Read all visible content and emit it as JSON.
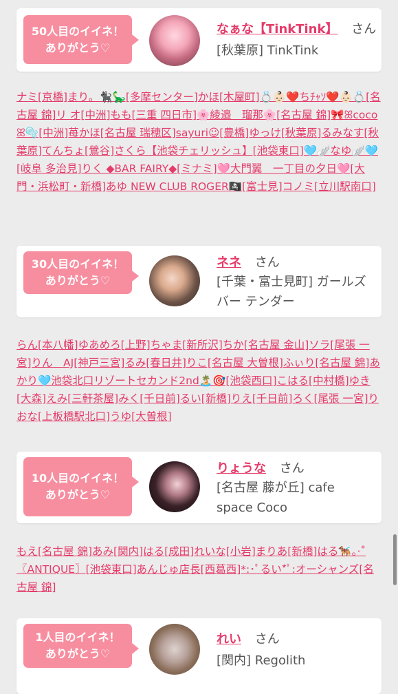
{
  "cards": [
    {
      "badge_line1": "50人目のイイネ！",
      "badge_line2": "ありがとう♡",
      "name": "なぁな【TinkTink】",
      "honorific": "さん",
      "shop": "[秋葉原] TinkTink"
    },
    {
      "badge_line1": "30人目のイイネ！",
      "badge_line2": "ありがとう♡",
      "name": "ネネ",
      "honorific": "さん",
      "shop": "[千葉・富士見町] ガールズバー テンダー"
    },
    {
      "badge_line1": "10人目のイイネ！",
      "badge_line2": "ありがとう♡",
      "name": "りょうな",
      "honorific": "さん",
      "shop": "[名古屋 藤が丘] cafe space Coco"
    },
    {
      "badge_line1": "1人目のイイネ！",
      "badge_line2": "ありがとう♡",
      "name": "れい",
      "honorific": "さん",
      "shop": "[関内] Regolith"
    }
  ],
  "likers": [
    "ナミ[京橋]まり。🐈‍⬛🦕[多摩センター]かほ[木屋町]💍👶🏻❤️ちﾁｬｿ❤️👶🏻💍[名古屋 錦]リ オ[中洲]もも[三重 四日市]🌸綾邉　瑠那🌸[名古屋 錦]🎀ꕤcocoꕤ🫧[中洲]苺かほ[名古屋 瑞穂区]sayuri☺[豊橋]ゆっけ[秋葉原]るみなす[秋葉原]てんちょ[鶯谷]さくら【池袋チェリッシュ】[池袋東口]🩵🪽なゆ🪽🩵[岐阜 多治見]りく ◆BAR FAIRY◆[ミナミ]🩷大門翼　一丁目の夕日🩷[大門・浜松町・新橋]あゆ NEW CLUB ROGER🏴‍☠️[富士見]コノミ[立川駅南口]",
    "らん[本八幡]ゆあめろ[上野]ちゃま[新所沢]ちか[名古屋 金山]ソラ[尾張 一宮]りん　AJ[神戸三宮]るみ[春日井]りこ[名古屋 大曽根]ふぃり[名古屋 錦]あかり🩵池袋北口リゾートセカンド2nd🏝️🎯[池袋西口]こはる[中村橋]ゆき[大森]えみ[三軒茶屋]みく[千日前]るい[新橋]りえ[千日前]ろく[尾張 一宮]りおな[上板橋駅北口]うゆ[大曽根]",
    "もえ[名古屋 錦]あみ[関内]はる[成田]れいな[小岩]まりあ[新橋]はる🐕‍🦺｡·˚〖ANTIQUE〗[池袋東口]あんじゅ店長[西葛西]*:･ﾟるい*ﾟ:オーシャンズ[名古屋 錦]"
  ]
}
